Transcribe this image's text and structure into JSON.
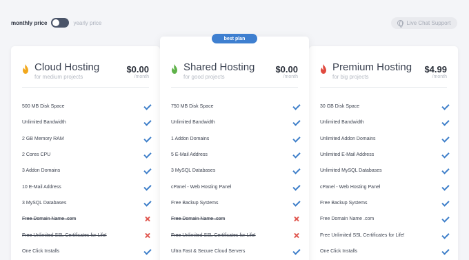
{
  "pricing_toggle": {
    "monthly_label": "monthly price",
    "yearly_label": "yearly price",
    "selected": "monthly"
  },
  "live_chat": {
    "label": "Live Chat Support"
  },
  "badge": "best plan",
  "colors": {
    "accent": "#3e7fd0",
    "check": "#3d7ec9",
    "cross": "#e0574f",
    "flame_cloud": "#f2a81d",
    "flame_shared": "#5fb24a",
    "flame_premium": "#e04a3f"
  },
  "plans": [
    {
      "name": "Cloud Hosting",
      "subtitle": "for medium projects",
      "price": "$0.00",
      "period": "/month",
      "features": [
        {
          "text": "500 MB Disk Space",
          "included": true
        },
        {
          "text": "Unlimited Bandwidth",
          "included": true
        },
        {
          "text": "2 GB Memory RAM",
          "included": true
        },
        {
          "text": "2 Cores CPU",
          "included": true
        },
        {
          "text": "3 Addon Domains",
          "included": true
        },
        {
          "text": "10 E-Mail Address",
          "included": true
        },
        {
          "text": "3 MySQL Databases",
          "included": true
        },
        {
          "text": "Free Domain Name .com",
          "included": false
        },
        {
          "text": "Free Unlimited SSL Certificates for Life!",
          "included": false
        },
        {
          "text": "One Click Installs",
          "included": true
        }
      ]
    },
    {
      "name": "Shared Hosting",
      "subtitle": "for good projects",
      "price": "$0.00",
      "period": "/month",
      "features": [
        {
          "text": "750 MB Disk Space",
          "included": true
        },
        {
          "text": "Unlimited Bandwidth",
          "included": true
        },
        {
          "text": "1 Addon Domains",
          "included": true
        },
        {
          "text": "5 E-Mail Address",
          "included": true
        },
        {
          "text": "3 MySQL Databases",
          "included": true
        },
        {
          "text": "cPanel - Web Hosting Panel",
          "included": true
        },
        {
          "text": "Free Backup Systems",
          "included": true
        },
        {
          "text": "Free Domain Name .com",
          "included": false
        },
        {
          "text": "Free Unlimited SSL Certificates for Life!",
          "included": false
        },
        {
          "text": "Ultra Fast & Secure Cloud Servers",
          "included": true
        }
      ]
    },
    {
      "name": "Premium Hosting",
      "subtitle": "for big projects",
      "price": "$4.99",
      "period": "/month",
      "features": [
        {
          "text": "30 GB Disk Space",
          "included": true
        },
        {
          "text": "Unlimited Bandwidth",
          "included": true
        },
        {
          "text": "Unlimited Addon Domains",
          "included": true
        },
        {
          "text": "Unlimited E-Mail Address",
          "included": true
        },
        {
          "text": "Unlimited MySQL Databases",
          "included": true
        },
        {
          "text": "cPanel - Web Hosting Panel",
          "included": true
        },
        {
          "text": "Free Backup Systems",
          "included": true
        },
        {
          "text": "Free Domain Name .com",
          "included": true
        },
        {
          "text": "Free Unlimited SSL Certificates for Life!",
          "included": true
        },
        {
          "text": "One Click Installs",
          "included": true
        }
      ]
    }
  ]
}
